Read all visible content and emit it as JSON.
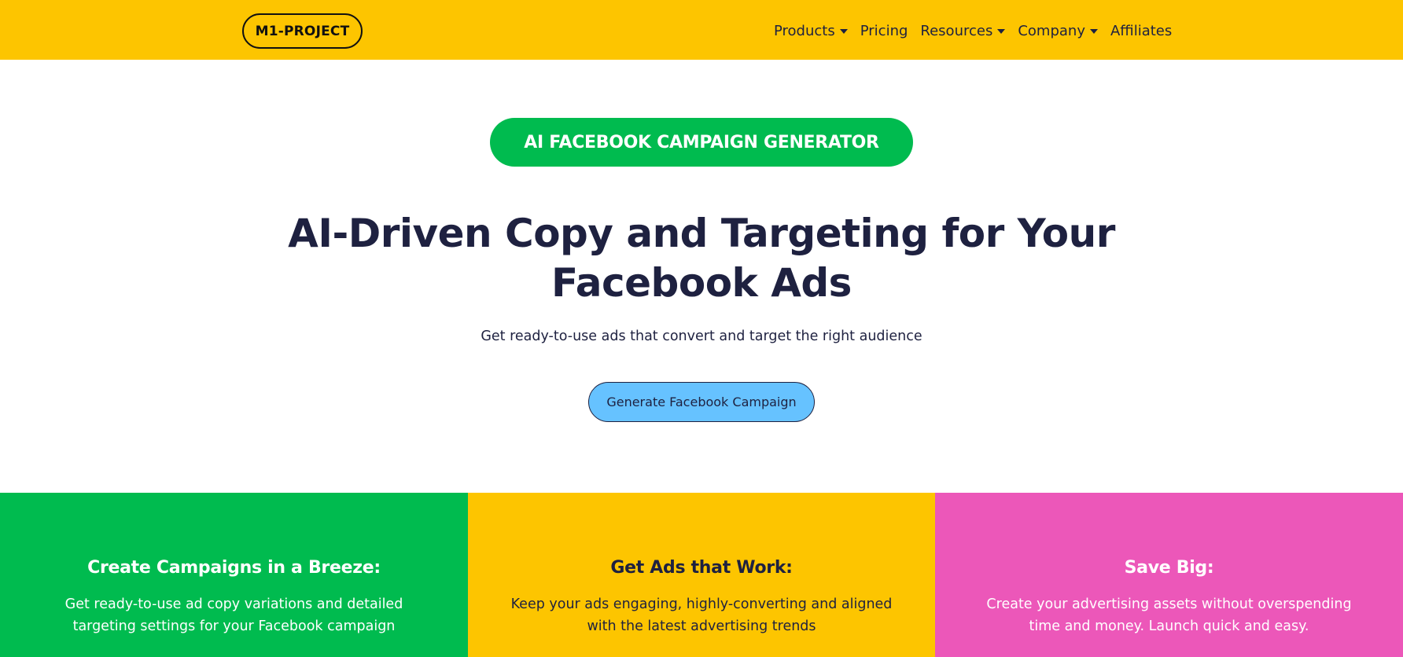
{
  "header": {
    "logo_text": "M1-PROJECT",
    "nav": [
      {
        "label": "Products",
        "has_dropdown": true
      },
      {
        "label": "Pricing",
        "has_dropdown": false
      },
      {
        "label": "Resources",
        "has_dropdown": true
      },
      {
        "label": "Company",
        "has_dropdown": true
      },
      {
        "label": "Affiliates",
        "has_dropdown": false
      }
    ]
  },
  "hero": {
    "badge": "AI FACEBOOK CAMPAIGN GENERATOR",
    "headline_line1": "AI-Driven Copy and Targeting for Your",
    "headline_line2": "Facebook Ads",
    "subheadline": "Get ready-to-use ads that convert and target the right audience",
    "cta_label": "Generate Facebook Campaign"
  },
  "features": [
    {
      "title": "Create Campaigns in a Breeze:",
      "description": "Get ready-to-use ad copy variations and detailed targeting settings for your Facebook campaign",
      "background": "#00bb4f",
      "text_color": "#ffffff"
    },
    {
      "title": "Get Ads that Work:",
      "description": "Keep your ads engaging, highly-converting and aligned with the latest advertising trends",
      "background": "#fdc500",
      "text_color": "#1e2140"
    },
    {
      "title": "Save Big:",
      "description": "Create your advertising assets without overspending time and money. Launch quick and easy.",
      "background": "#ec57b9",
      "text_color": "#ffffff"
    }
  ],
  "colors": {
    "header_bg": "#fdc500",
    "badge_bg": "#00bb4f",
    "cta_bg": "#66c2ff",
    "text_dark": "#1e2140"
  }
}
